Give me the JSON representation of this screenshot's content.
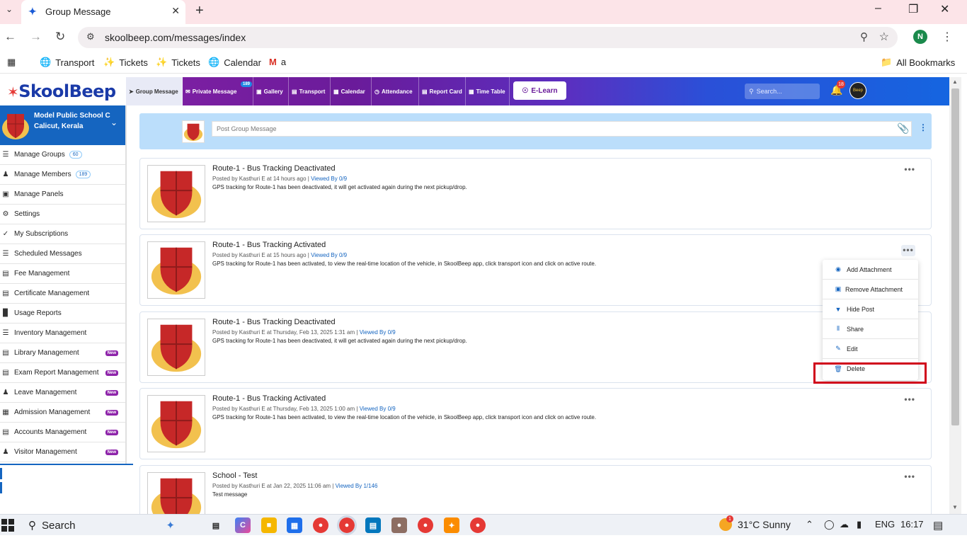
{
  "browser": {
    "tab_title": "Group Message",
    "url": "skoolbeep.com/messages/index",
    "profile_initial": "N",
    "bookmarks": [
      {
        "label": "Transport",
        "icon": "globe-icon"
      },
      {
        "label": "Tickets",
        "icon": "ticket-icon"
      },
      {
        "label": "Tickets",
        "icon": "ticket-icon"
      },
      {
        "label": "Calendar",
        "icon": "globe-icon"
      },
      {
        "label": "a",
        "icon": "gmail-icon"
      }
    ],
    "all_bookmarks": "All Bookmarks"
  },
  "app": {
    "logo": "SkoolBeep",
    "nav": [
      {
        "label": "Group Message",
        "icon": "send-icon"
      },
      {
        "label": "Private Message",
        "icon": "mail-icon",
        "badge": "189"
      },
      {
        "label": "Gallery",
        "icon": "image-icon"
      },
      {
        "label": "Transport",
        "icon": "bus-icon"
      },
      {
        "label": "Calendar",
        "icon": "calendar-icon"
      },
      {
        "label": "Attendance",
        "icon": "clock-icon"
      },
      {
        "label": "Report Card",
        "icon": "report-icon"
      },
      {
        "label": "Time Table",
        "icon": "calendar-icon"
      }
    ],
    "elearn": "E-Learn",
    "search_placeholder": "Search...",
    "notif_count": "18",
    "avatar_text": "Beep"
  },
  "school": {
    "name": "Model Public School C",
    "location": "Calicut, Kerala"
  },
  "sidebar": {
    "items": [
      {
        "label": "Manage Groups",
        "icon": "list-icon",
        "count": "60"
      },
      {
        "label": "Manage Members",
        "icon": "users-icon",
        "count": "189"
      },
      {
        "label": "Manage Panels",
        "icon": "monitor-icon"
      },
      {
        "label": "Settings",
        "icon": "gear-icon"
      },
      {
        "label": "My Subscriptions",
        "icon": "check-icon"
      },
      {
        "label": "Scheduled Messages",
        "icon": "list-icon"
      },
      {
        "label": "Fee Management",
        "icon": "file-icon"
      },
      {
        "label": "Certificate Management",
        "icon": "file-icon"
      },
      {
        "label": "Usage Reports",
        "icon": "bar-chart-icon"
      },
      {
        "label": "Inventory Management",
        "icon": "list-icon"
      },
      {
        "label": "Library Management",
        "icon": "file-icon",
        "badge": "New"
      },
      {
        "label": "Exam Report Management",
        "icon": "file-icon",
        "badge": "New"
      },
      {
        "label": "Leave Management",
        "icon": "person-icon",
        "badge": "New"
      },
      {
        "label": "Admission Management",
        "icon": "id-card-icon",
        "badge": "New"
      },
      {
        "label": "Accounts Management",
        "icon": "file-icon",
        "badge": "New"
      },
      {
        "label": "Visitor Management",
        "icon": "users-icon",
        "badge": "New"
      }
    ]
  },
  "compose": {
    "placeholder": "Post Group Message"
  },
  "posts": [
    {
      "title": "Route-1 - Bus Tracking Deactivated",
      "meta": "Posted by Kasthuri E at 14 hours ago  |",
      "viewed": "Viewed By 0/9",
      "body": "GPS tracking for Route-1 has been deactivated, it will get activated again during the next pickup/drop."
    },
    {
      "title": "Route-1 - Bus Tracking Activated",
      "meta": "Posted by Kasthuri E at 15 hours ago  |",
      "viewed": "Viewed By 0/9",
      "body": "GPS tracking for Route-1 has been activated, to view the real-time location of the vehicle, in SkoolBeep app, click transport icon and click on active route."
    },
    {
      "title": "Route-1 - Bus Tracking Deactivated",
      "meta": "Posted by Kasthuri E at Thursday, Feb 13, 2025 1:31 am  |",
      "viewed": "Viewed By 0/9",
      "body": "GPS tracking for Route-1 has been deactivated, it will get activated again during the next pickup/drop."
    },
    {
      "title": "Route-1 - Bus Tracking Activated",
      "meta": "Posted by Kasthuri E at Thursday, Feb 13, 2025 1:00 am  |",
      "viewed": "Viewed By 0/9",
      "body": "GPS tracking for Route-1 has been activated, to view the real-time location of the vehicle, in SkoolBeep app, click transport icon and click on active route."
    },
    {
      "title": "School - Test",
      "meta": "Posted by Kasthuri E at Jan 22, 2025 11:06 am  |",
      "viewed": "Viewed By 1/146",
      "body": "Test message"
    }
  ],
  "context_menu": [
    {
      "label": "Add Attachment",
      "icon": "camera-icon"
    },
    {
      "label": "Remove Attachment",
      "icon": "image-icon"
    },
    {
      "label": "Hide Post",
      "icon": "thumbs-down-icon"
    },
    {
      "label": "Share",
      "icon": "share-icon"
    },
    {
      "label": "Edit",
      "icon": "pencil-icon"
    },
    {
      "label": "Delete",
      "icon": "trash-icon"
    }
  ],
  "taskbar": {
    "search": "Search",
    "weather": "31°C  Sunny",
    "weather_badge": "1",
    "lang": "ENG",
    "time": "16:17"
  }
}
